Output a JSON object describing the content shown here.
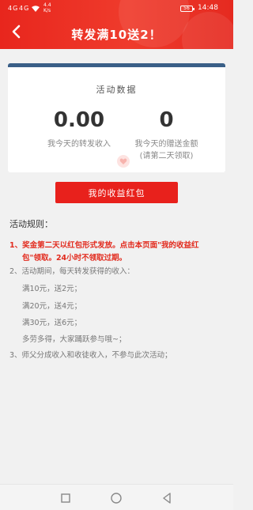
{
  "status_bar": {
    "signal1": "4G",
    "signal2": "4G",
    "net_speed_value": "4.4",
    "net_speed_unit": "K/s",
    "battery": "56",
    "time": "14:48"
  },
  "header": {
    "title": "转发满10送2！"
  },
  "stats_card": {
    "title": "活动数据",
    "left_value": "0.00",
    "left_label": "我今天的转发收入",
    "right_value": "0",
    "right_label": "我今天的赠送金额",
    "right_note": "(请第二天领取)"
  },
  "earnings_button": {
    "label": "我的收益红包"
  },
  "rules": {
    "title": "活动规则：",
    "rule1_line1": "1、奖金第二天以红包形式发放。点击本页面\"我的收益红",
    "rule1_line2": "包\"领取。24小时不领取过期。",
    "rule2": "2、活动期间，每天转发获得的收入：",
    "tier1": "满10元，送2元；",
    "tier2": "满20元，送4元；",
    "tier3": "满30元，送6元；",
    "encourage": "多劳多得，大家踊跃参与哦~；",
    "rule3": "3、师父分成收入和收徒收入，不参与此次活动；"
  },
  "colors": {
    "header_red": "#e8261d",
    "button_red": "#e8211c",
    "card_accent": "#3a5f87",
    "rule_highlight": "#e22b1e"
  },
  "icons": {
    "back": "chevron-left-icon",
    "nav_recent": "square-icon",
    "nav_home": "circle-icon",
    "nav_back": "triangle-icon"
  }
}
